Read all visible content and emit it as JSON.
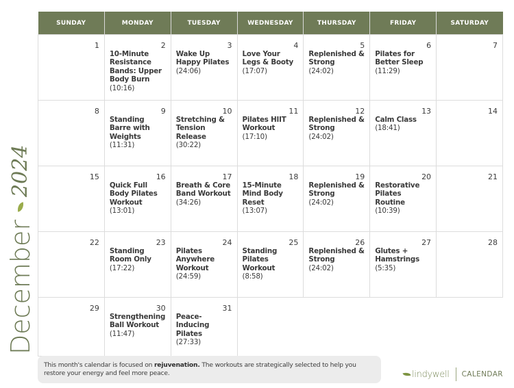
{
  "side_title": {
    "month": "December",
    "year": "2024",
    "separator_icon": "leaf-icon"
  },
  "calendar": {
    "weekdays": [
      "SUNDAY",
      "MONDAY",
      "TUESDAY",
      "WEDNESDAY",
      "THURSDAY",
      "FRIDAY",
      "SATURDAY"
    ],
    "weeks": [
      [
        {
          "day": "1"
        },
        {
          "day": "2",
          "title": "10-Minute Resistance Bands: Upper Body Burn",
          "duration": "(10:16)"
        },
        {
          "day": "3",
          "title": "Wake Up Happy Pilates",
          "duration": "(24:06)"
        },
        {
          "day": "4",
          "title": "Love Your Legs & Booty",
          "duration": "(17:07)"
        },
        {
          "day": "5",
          "title": "Replenished & Strong",
          "duration": "(24:02)"
        },
        {
          "day": "6",
          "title": "Pilates for Better Sleep",
          "duration": "(11:29)"
        },
        {
          "day": "7"
        }
      ],
      [
        {
          "day": "8"
        },
        {
          "day": "9",
          "title": "Standing Barre with Weights",
          "duration": "(11:31)"
        },
        {
          "day": "10",
          "title": "Stretching & Tension Release",
          "duration": "(30:22)"
        },
        {
          "day": "11",
          "title": "Pilates HIIT Workout",
          "duration": "(17:10)"
        },
        {
          "day": "12",
          "title": "Replenished & Strong",
          "duration": "(24:02)"
        },
        {
          "day": "13",
          "title": "Calm Class",
          "duration": "(18:41)"
        },
        {
          "day": "14"
        }
      ],
      [
        {
          "day": "15"
        },
        {
          "day": "16",
          "title": "Quick Full Body Pilates Workout",
          "duration": "(13:01)"
        },
        {
          "day": "17",
          "title": "Breath & Core Band Workout",
          "duration": "(34:26)"
        },
        {
          "day": "18",
          "title": "15-Minute Mind Body Reset",
          "duration": "(13:07)"
        },
        {
          "day": "19",
          "title": "Replenished & Strong",
          "duration": "(24:02)"
        },
        {
          "day": "20",
          "title": "Restorative Pilates Routine",
          "duration": "(10:39)"
        },
        {
          "day": "21"
        }
      ],
      [
        {
          "day": "22"
        },
        {
          "day": "23",
          "title": "Standing Room Only",
          "duration": "(17:22)"
        },
        {
          "day": "24",
          "title": "Pilates Anywhere Workout",
          "duration": "(24:59)"
        },
        {
          "day": "25",
          "title": "Standing Pilates Workout",
          "duration": "(8:58)"
        },
        {
          "day": "26",
          "title": "Replenished & Strong",
          "duration": "(24:02)"
        },
        {
          "day": "27",
          "title": "Glutes + Hamstrings",
          "duration": "(5:35)"
        },
        {
          "day": "28"
        }
      ],
      [
        {
          "day": "29"
        },
        {
          "day": "30",
          "title": "Strengthening Ball Workout",
          "duration": "(11:47)"
        },
        {
          "day": "31",
          "title": "Peace-Inducing Pilates",
          "duration": "(27:33)"
        },
        {
          "day": ""
        },
        {
          "day": ""
        },
        {
          "day": ""
        },
        {
          "day": ""
        }
      ]
    ]
  },
  "footer": {
    "note_before": "This month's calendar is focused on ",
    "note_emphasis": "rejuvenation.",
    "note_after": " The workouts are strategically selected to help you restore your energy and feel more peace."
  },
  "brand": {
    "logo_icon": "leaf-icon",
    "name": "lindywell",
    "label": "CALENDAR"
  },
  "colors": {
    "header_bg": "#6f7b57",
    "accent_green": "#6e7b56",
    "leaf_green": "#9aac4c",
    "note_bg": "#ececec"
  }
}
